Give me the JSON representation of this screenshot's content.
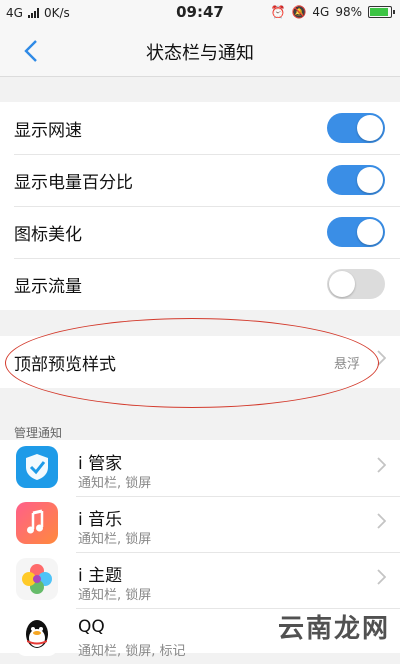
{
  "statusbar": {
    "network": "4G",
    "speed": "0K/s",
    "time": "09:47",
    "right_network": "4G",
    "battery": "98%",
    "battery_level": 0.98,
    "battery_color": "#3cc444"
  },
  "header": {
    "back_icon": "chevron-left-icon",
    "title": "状态栏与通知"
  },
  "settings": [
    {
      "label": "显示网速",
      "on": true
    },
    {
      "label": "显示电量百分比",
      "on": true
    },
    {
      "label": "图标美化",
      "on": true
    },
    {
      "label": "显示流量",
      "on": false
    }
  ],
  "preview": {
    "label": "顶部预览样式",
    "value": "悬浮",
    "annotation_color": "#d33a2c"
  },
  "section_title": "管理通知",
  "apps": [
    {
      "name": "i 管家",
      "sub": "通知栏, 锁屏",
      "icon": "shield-check-icon"
    },
    {
      "name": "i 音乐",
      "sub": "通知栏, 锁屏",
      "icon": "music-note-icon"
    },
    {
      "name": "i 主题",
      "sub": "通知栏, 锁屏",
      "icon": "theme-flower-icon"
    },
    {
      "name": "QQ",
      "sub": "通知栏, 锁屏, 标记",
      "icon": "qq-penguin-icon"
    }
  ],
  "watermark": "云南龙网",
  "colors": {
    "accent": "#3a8ee6",
    "toggle_off": "#dcdcdc"
  }
}
